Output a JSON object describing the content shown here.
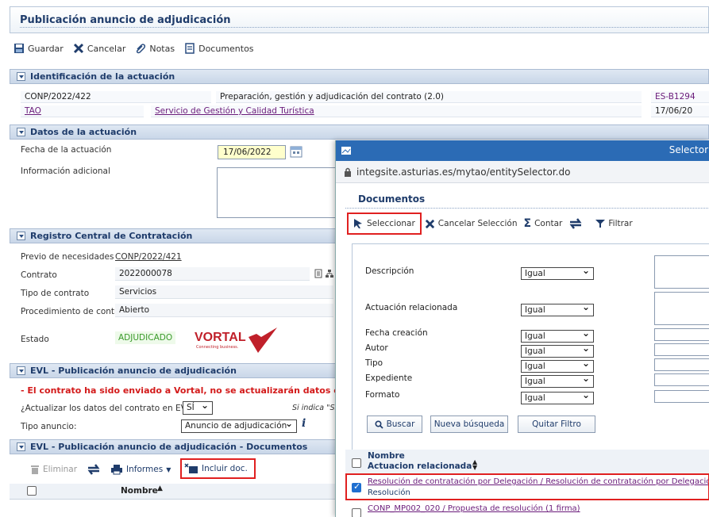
{
  "page": {
    "title": "Publicación anuncio de adjudicación",
    "toolbar": {
      "save": "Guardar",
      "cancel": "Cancelar",
      "notes": "Notas",
      "documents": "Documentos"
    }
  },
  "identificacion": {
    "header": "Identificación de la actuación",
    "code": "CONP/2022/422",
    "description": "Preparación, gestión y adjudicación del contrato (2.0)",
    "ref": "ES-B1294",
    "unit": "TAO",
    "service": "Servicio de Gestión y Calidad Turística",
    "date": "17/06/20"
  },
  "datos": {
    "header": "Datos de la actuación",
    "fecha_label": "Fecha de la actuación",
    "fecha_value": "17/06/2022",
    "info_label": "Información adicional"
  },
  "registro": {
    "header": "Registro Central de Contratación",
    "previo_label": "Previo de necesidades",
    "previo_value": "CONP/2022/421",
    "contrato_label": "Contrato",
    "contrato_value": "2022000078",
    "tipo_label": "Tipo de contrato",
    "tipo_value": "Servicios",
    "proc_label": "Procedimiento de contr.",
    "proc_value": "Abierto",
    "estado_label": "Estado",
    "estado_value": "ADJUDICADO",
    "vortal_logo": "VORTAL",
    "vortal_tagline": "Connecting business."
  },
  "evl": {
    "header": "EVL - Publicación anuncio de adjudicación",
    "warning": "- El contrato ha sido enviado a Vortal, no se actualizarán datos con EVL",
    "actualizar_label": "¿Actualizar los datos del contrato en EVL?:",
    "actualizar_value": "SÍ",
    "hint": "Si indica \"SÍ",
    "tipo_label": "Tipo anuncio:",
    "tipo_value": "Anuncio de adjudicación"
  },
  "evl_docs": {
    "header": "EVL - Publicación anuncio de adjudicación - Documentos",
    "eliminar": "Eliminar",
    "informes": "Informes",
    "incluir": "Incluir doc.",
    "col_nombre": "Nombre"
  },
  "popup": {
    "title": "Selector",
    "url": "integsite.asturias.es/mytao/entitySelector.do",
    "section": "Documentos",
    "toolbar": {
      "select": "Seleccionar",
      "cancel_select": "Cancelar Selección",
      "count": "Contar",
      "filter": "Filtrar"
    },
    "filters": [
      {
        "label": "Descripción",
        "op": "Igual"
      },
      {
        "label": "Actuación relacionada",
        "op": "Igual"
      },
      {
        "label": "Fecha creación",
        "op": "Igual"
      },
      {
        "label": "Autor",
        "op": "Igual"
      },
      {
        "label": "Tipo",
        "op": "Igual"
      },
      {
        "label": "Expediente",
        "op": "Igual"
      },
      {
        "label": "Formato",
        "op": "Igual"
      }
    ],
    "buttons": {
      "search": "Buscar",
      "new_search": "Nueva búsqueda",
      "clear_filter": "Quitar Filtro"
    },
    "list_header": {
      "col1": "Nombre",
      "col2": "Actuacion relacionada"
    },
    "rows": [
      {
        "name": "Resolución de contratación por Delegación / Resolución de contratación por Delegación",
        "rel": "Resolución",
        "checked": true
      },
      {
        "name": "CONP_MP002_020 / Propuesta de resolución (1 firma)",
        "rel": "",
        "checked": false
      }
    ]
  },
  "colors": {
    "accent": "#1f3c6b",
    "highlight": "#e02020",
    "warning": "#d31a1a",
    "titlebar": "#2b6bb5"
  }
}
